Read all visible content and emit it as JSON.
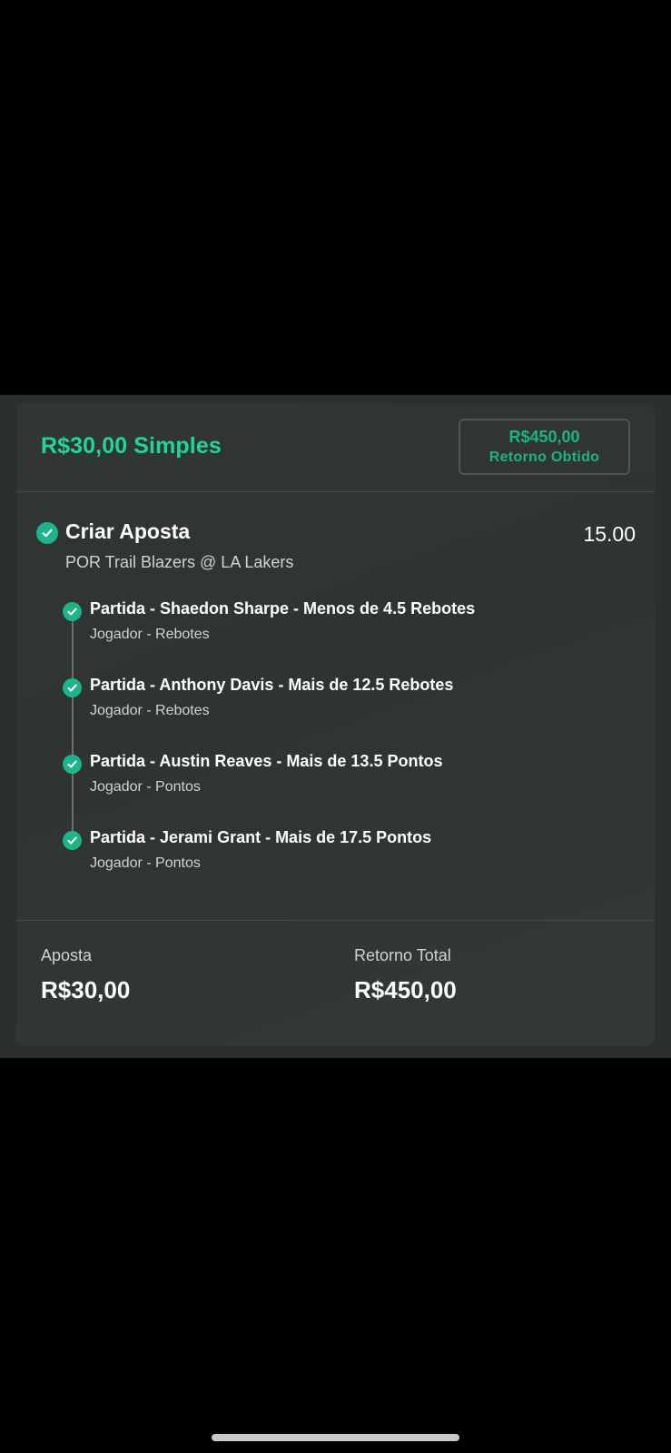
{
  "bet": {
    "stake_type": "R$30,00 Simples",
    "return_box": {
      "amount": "R$450,00",
      "label": "Retorno Obtido"
    },
    "title": "Criar Aposta",
    "odds": "15.00",
    "event": "POR Trail Blazers @ LA Lakers",
    "legs": [
      {
        "title": "Partida - Shaedon Sharpe - Menos de 4.5 Rebotes",
        "market": "Jogador - Rebotes"
      },
      {
        "title": "Partida - Anthony Davis - Mais de 12.5 Rebotes",
        "market": "Jogador - Rebotes"
      },
      {
        "title": "Partida - Austin Reaves - Mais de 13.5 Pontos",
        "market": "Jogador - Pontos"
      },
      {
        "title": "Partida - Jerami Grant - Mais de 17.5 Pontos",
        "market": "Jogador - Pontos"
      }
    ],
    "footer": {
      "stake_label": "Aposta",
      "stake_value": "R$30,00",
      "return_label": "Retorno Total",
      "return_value": "R$450,00"
    }
  },
  "colors": {
    "accent_green": "#1ed59c",
    "check_green": "#1bb589",
    "card_bg": "#313634"
  },
  "icons": {
    "status": "check-circle-icon"
  }
}
